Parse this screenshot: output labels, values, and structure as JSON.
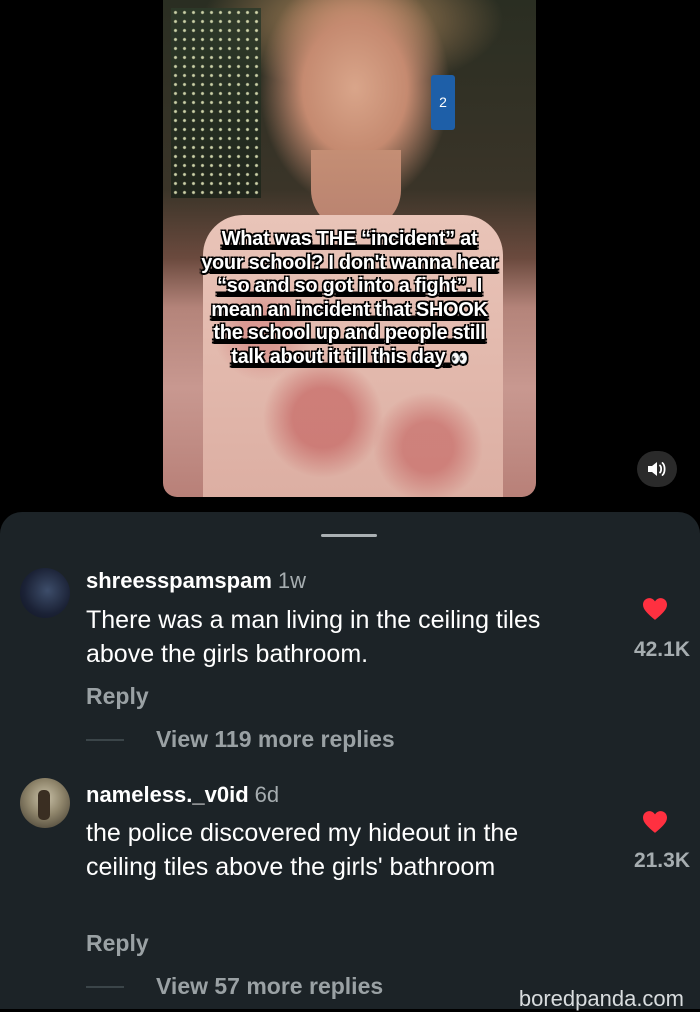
{
  "video": {
    "caption_text": "What was THE “incident” at your school? I don't wanna hear “so and so got into a fight”. I mean an incident that SHOOK the school up and people still talk about it till this day",
    "caption_emoji": "👀",
    "badge": "2",
    "sound_icon": "speaker-icon"
  },
  "comments": [
    {
      "username": "shreesspamspam",
      "time": "1w",
      "text": "There was a man living in the ceiling tiles above the girls bathroom.",
      "likes": "42.1K",
      "reply_label": "Reply",
      "view_replies": "View 119 more replies"
    },
    {
      "username": "nameless._v0id",
      "time": "6d",
      "text": "the police discovered my hideout in the ceiling tiles above the girls' bathroom",
      "likes": "21.3K",
      "reply_label": "Reply",
      "view_replies": "View 57 more replies"
    }
  ],
  "watermark": "boredpanda.com",
  "colors": {
    "heart": "#ff3040",
    "sheet": "#1c2327",
    "muted": "#9aa1a4"
  }
}
